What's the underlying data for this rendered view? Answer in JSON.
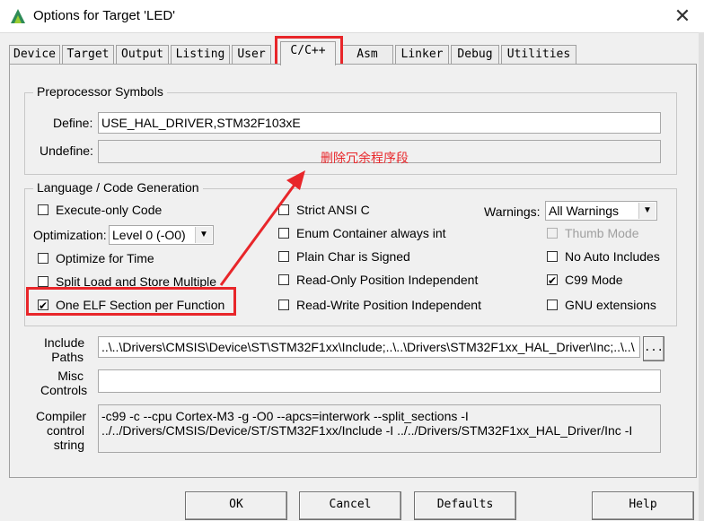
{
  "window": {
    "title": "Options for Target 'LED'",
    "close_glyph": "✕"
  },
  "tabs": [
    {
      "label": "Device"
    },
    {
      "label": "Target"
    },
    {
      "label": "Output"
    },
    {
      "label": "Listing"
    },
    {
      "label": "User"
    },
    {
      "label": "C/C++"
    },
    {
      "label": "Asm"
    },
    {
      "label": "Linker"
    },
    {
      "label": "Debug"
    },
    {
      "label": "Utilities"
    }
  ],
  "preprocessor": {
    "legend": "Preprocessor Symbols",
    "define_label": "Define:",
    "define_value": "USE_HAL_DRIVER,STM32F103xE",
    "undefine_label": "Undefine:",
    "undefine_value": ""
  },
  "annotation": {
    "text": "删除冗余程序段",
    "color": "#e8262a"
  },
  "codegen": {
    "legend": "Language / Code Generation",
    "execute_only": {
      "label": "Execute-only Code",
      "checked": false
    },
    "optimization_label": "Optimization:",
    "optimization_value": "Level 0 (-O0)",
    "optimize_time": {
      "label": "Optimize for Time",
      "checked": false
    },
    "split_load": {
      "label": "Split Load and Store Multiple",
      "checked": false
    },
    "one_elf": {
      "label": "One ELF Section per Function",
      "checked": true
    },
    "strict_ansi": {
      "label": "Strict ANSI C",
      "checked": false
    },
    "enum_container": {
      "label": "Enum Container always int",
      "checked": false
    },
    "plain_char": {
      "label": "Plain Char is Signed",
      "checked": false
    },
    "ropi": {
      "label": "Read-Only Position Independent",
      "checked": false
    },
    "rwpi": {
      "label": "Read-Write Position Independent",
      "checked": false
    },
    "warnings_label": "Warnings:",
    "warnings_value": "All Warnings",
    "thumb_mode": {
      "label": "Thumb Mode",
      "checked": false,
      "disabled": true
    },
    "no_auto_includes": {
      "label": "No Auto Includes",
      "checked": false
    },
    "c99_mode": {
      "label": "C99 Mode",
      "checked": true
    },
    "gnu_ext": {
      "label": "GNU extensions",
      "checked": false
    }
  },
  "include": {
    "label_line1": "Include",
    "label_line2": "Paths",
    "value": "..\\..\\Drivers\\CMSIS\\Device\\ST\\STM32F1xx\\Include;..\\..\\Drivers\\STM32F1xx_HAL_Driver\\Inc;..\\..\\",
    "browse_label": "..."
  },
  "misc": {
    "label_line1": "Misc",
    "label_line2": "Controls",
    "value": ""
  },
  "compiler": {
    "label_line1": "Compiler",
    "label_line2": "control",
    "label_line3": "string",
    "line1": "-c99 -c --cpu Cortex-M3 -g -O0 --apcs=interwork --split_sections -I",
    "line2": "../../Drivers/CMSIS/Device/ST/STM32F1xx/Include -I ../../Drivers/STM32F1xx_HAL_Driver/Inc -I"
  },
  "buttons": {
    "ok": "OK",
    "cancel": "Cancel",
    "defaults": "Defaults",
    "help": "Help"
  },
  "colors": {
    "highlight_red": "#e8262a",
    "check_glyph": "✔"
  }
}
